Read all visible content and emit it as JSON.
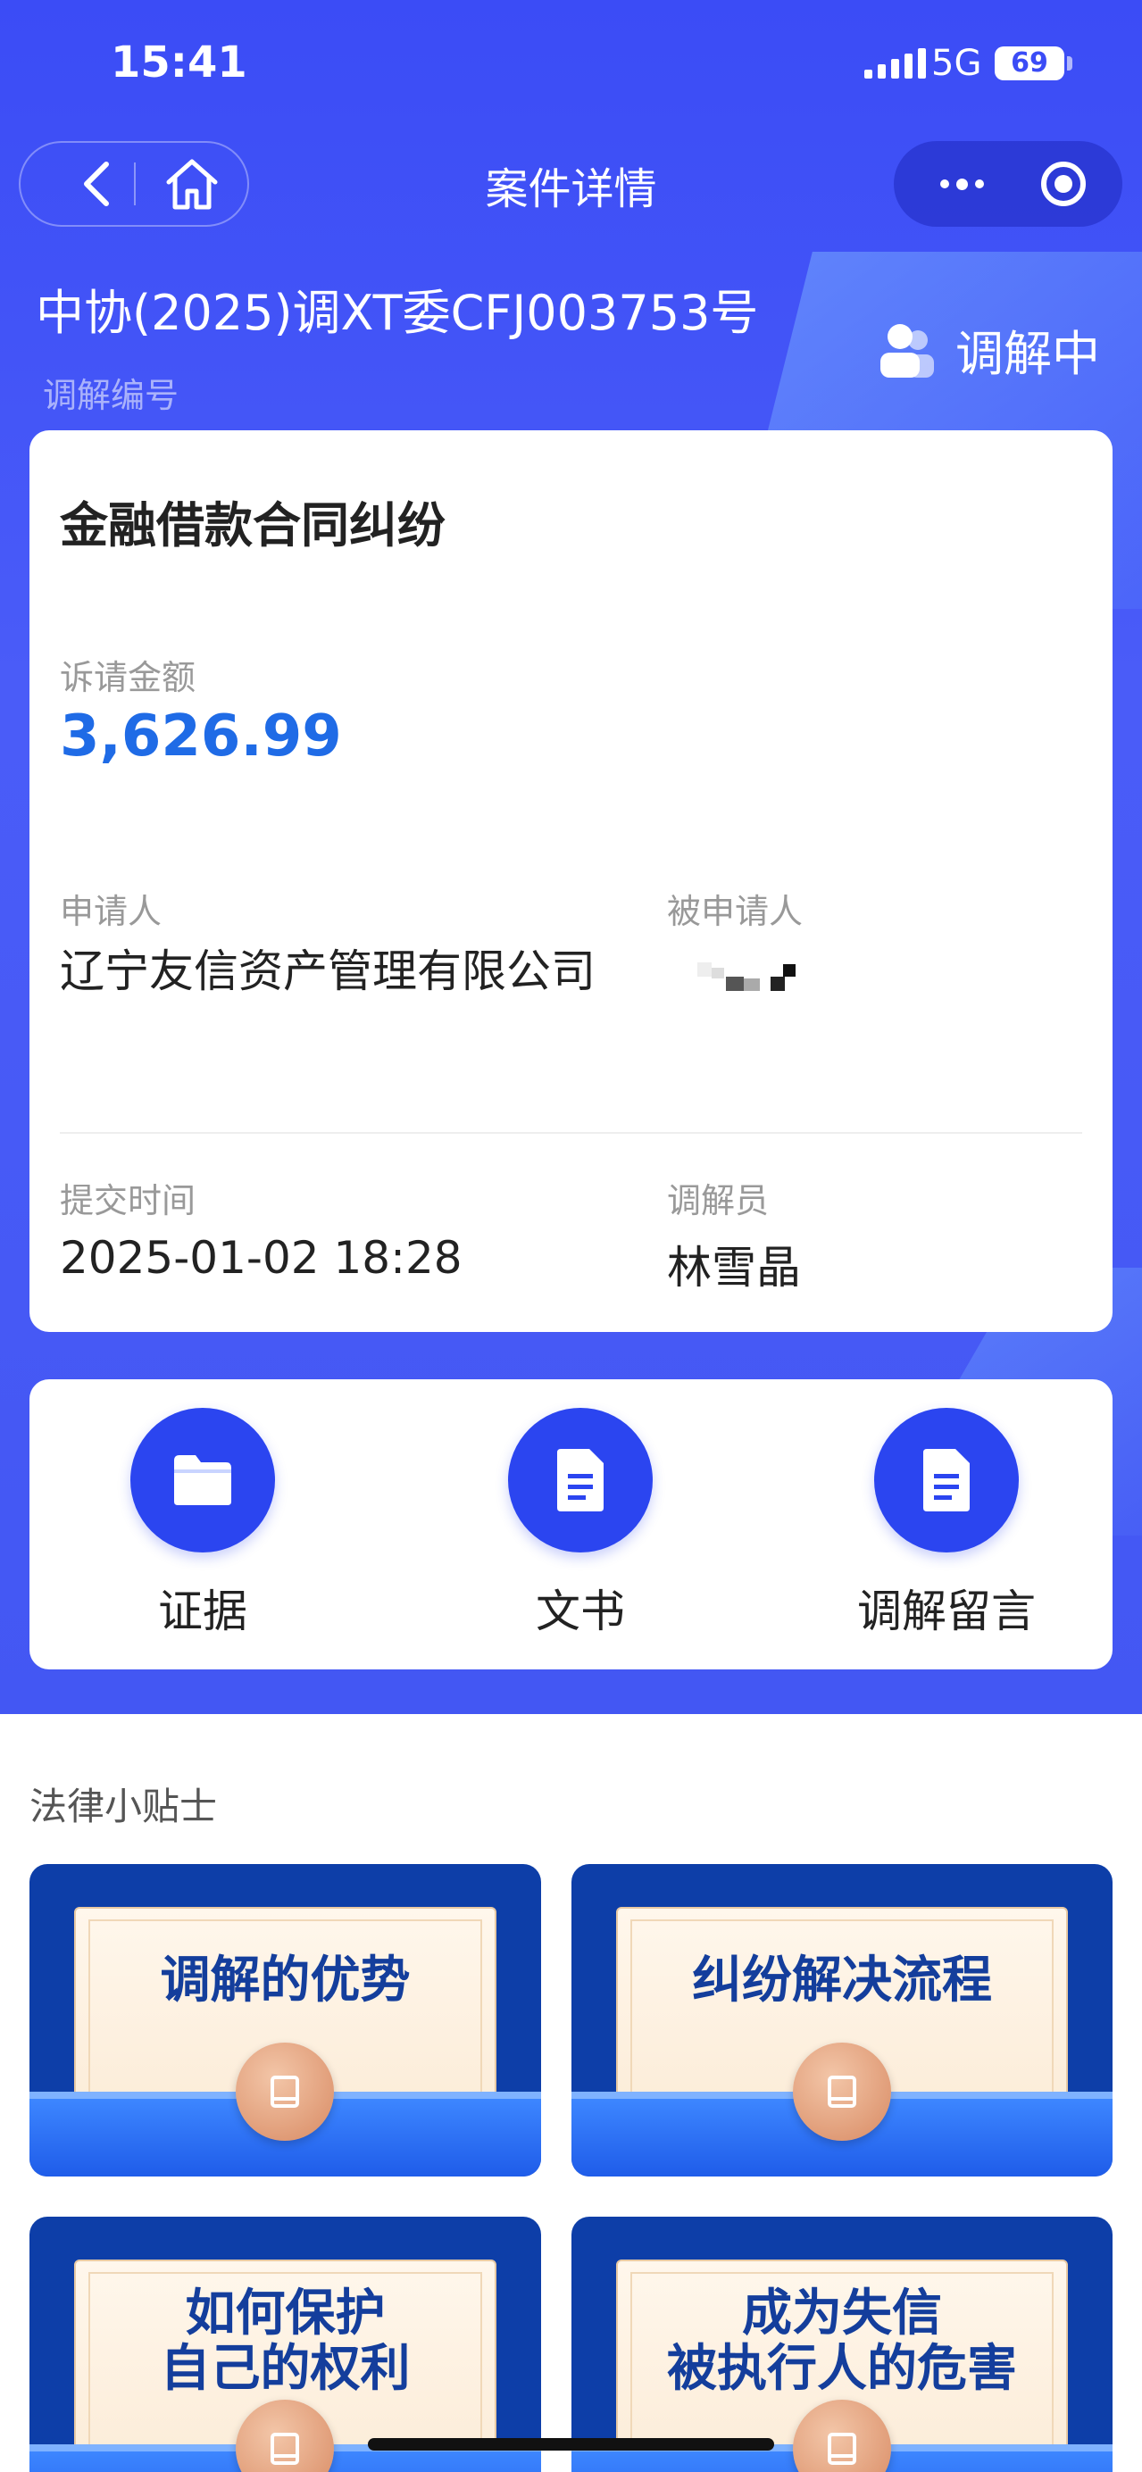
{
  "status_bar": {
    "time": "15:41",
    "network": "5G",
    "battery": "69"
  },
  "nav": {
    "title": "案件详情",
    "back_icon": "chevron-left-icon",
    "home_icon": "home-icon",
    "more_icon": "more-dots-icon",
    "target_icon": "target-icon"
  },
  "case": {
    "number": "中协(2025)调XT委CFJ003753号",
    "number_label": "调解编号",
    "status": "调解中"
  },
  "info": {
    "type": "金融借款合同纠纷",
    "amount_label": "诉请金额",
    "amount": "3,626.99",
    "applicant_label": "申请人",
    "applicant": "辽宁友信资产管理有限公司",
    "respondent_label": "被申请人",
    "submit_time_label": "提交时间",
    "submit_time": "2025-01-02 18:28",
    "mediator_label": "调解员",
    "mediator": "林雪晶"
  },
  "actions": [
    {
      "label": "证据",
      "icon": "folder-icon"
    },
    {
      "label": "文书",
      "icon": "document-icon"
    },
    {
      "label": "调解留言",
      "icon": "document-icon"
    }
  ],
  "tips": {
    "title": "法律小贴士",
    "items": [
      {
        "line1": "调解的优势",
        "line2": ""
      },
      {
        "line1": "纠纷解决流程",
        "line2": ""
      },
      {
        "line1": "如何保护",
        "line2": "自己的权利"
      },
      {
        "line1": "成为失信",
        "line2": "被执行人的危害"
      }
    ]
  },
  "colors": {
    "brand_blue": "#3b4cf6",
    "amount_blue": "#1f6be6",
    "tip_navy": "#0d3ea8"
  }
}
